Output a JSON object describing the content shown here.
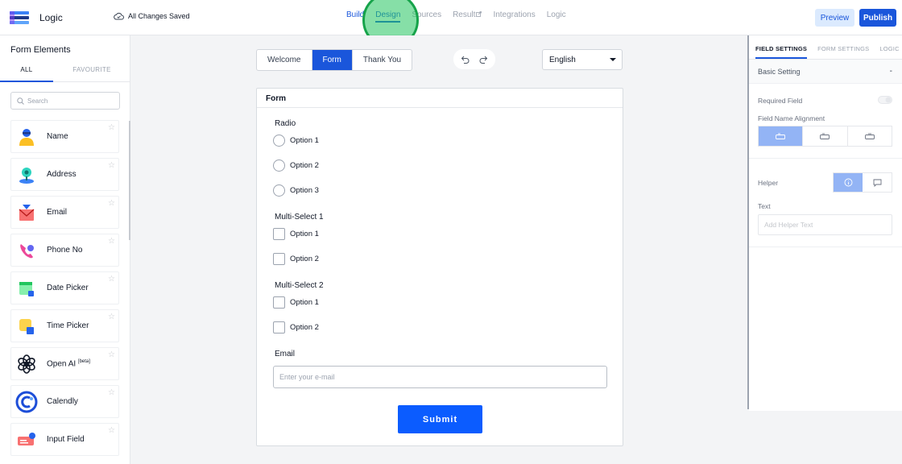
{
  "header": {
    "app_title": "Logic",
    "save_status": "All Changes Saved",
    "nav_tabs": [
      "Build",
      "Design",
      "Sources",
      "Result",
      "Integrations",
      "Logic"
    ],
    "preview_label": "Preview",
    "publish_label": "Publish",
    "accent_color": "#1a56db"
  },
  "left_panel": {
    "title": "Form Elements",
    "tabs": [
      "ALL",
      "FAVOURITE"
    ],
    "search_placeholder": "Search",
    "items": [
      {
        "label": "Name",
        "icon": "person-icon"
      },
      {
        "label": "Address",
        "icon": "address-pin-icon"
      },
      {
        "label": "Email",
        "icon": "envelope-icon"
      },
      {
        "label": "Phone No",
        "icon": "phone-icon"
      },
      {
        "label": "Date Picker",
        "icon": "calendar-icon"
      },
      {
        "label": "Time Picker",
        "icon": "clock-icon"
      },
      {
        "label": "Open AI",
        "badge": "[beta]",
        "icon": "openai-icon"
      },
      {
        "label": "Calendly",
        "icon": "calendly-icon"
      },
      {
        "label": "Input Field",
        "icon": "input-field-icon"
      }
    ]
  },
  "canvas": {
    "page_tabs": [
      "Welcome",
      "Form",
      "Thank You"
    ],
    "active_page_tab": "Form",
    "language": "English",
    "form": {
      "title": "Form",
      "radio_label": "Radio",
      "radio_options": [
        "Option 1",
        "Option 2",
        "Option 3"
      ],
      "multi1_label": "Multi-Select 1",
      "multi1_options": [
        "Option 1",
        "Option 2"
      ],
      "multi2_label": "Multi-Select 2",
      "multi2_options": [
        "Option 1",
        "Option 2"
      ],
      "email_label": "Email",
      "email_placeholder": "Enter your e-mail",
      "submit_label": "Submit"
    }
  },
  "right_panel": {
    "tabs": [
      "FIELD SETTINGS",
      "FORM SETTINGS",
      "LOGIC"
    ],
    "section_title": "Basic Setting",
    "section_toggle": "-",
    "required_label": "Required Field",
    "alignment_label": "Field Name Alignment",
    "helper_label": "Helper",
    "text_label": "Text",
    "helper_placeholder": "Add Helper Text"
  }
}
